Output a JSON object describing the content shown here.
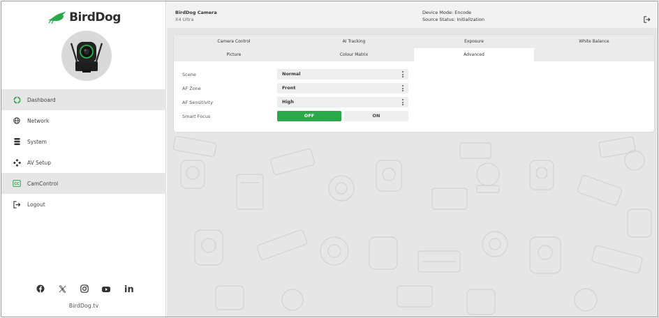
{
  "sidebar": {
    "brand": "BirdDog",
    "nav": [
      {
        "label": "Dashboard",
        "icon": "dashboard-icon",
        "active": true
      },
      {
        "label": "Network",
        "icon": "globe-icon",
        "active": false
      },
      {
        "label": "System",
        "icon": "database-icon",
        "active": false
      },
      {
        "label": "AV Setup",
        "icon": "av-setup-icon",
        "active": false
      },
      {
        "label": "CamControl",
        "icon": "cc-icon",
        "active": true
      },
      {
        "label": "Logout",
        "icon": "logout-icon",
        "active": false
      }
    ],
    "socials": [
      "facebook-icon",
      "x-icon",
      "instagram-icon",
      "youtube-icon",
      "linkedin-icon"
    ],
    "site": "BirdDog.tv"
  },
  "header": {
    "camera_name": "BirdDog Camera",
    "camera_model": "X4 Ultra",
    "device_mode": "Device Mode: Encode",
    "source_status": "Source Status: Initialization"
  },
  "tabs": {
    "row1": [
      "Camera Control",
      "AI Tracking",
      "Exposure",
      "White Balance"
    ],
    "row2": [
      "Picture",
      "Colour Matrix",
      "Advanced"
    ],
    "active": "Advanced"
  },
  "settings": {
    "scene": {
      "label": "Scene",
      "value": "Normal"
    },
    "af_zone": {
      "label": "AF Zone",
      "value": "Front"
    },
    "af_sensitivity": {
      "label": "AF Sensitivity",
      "value": "High"
    },
    "smart_focus": {
      "label": "Smart Focus",
      "off_label": "OFF",
      "on_label": "ON",
      "selected": "OFF"
    }
  },
  "colors": {
    "accent_green": "#2ba84a",
    "active_nav": "#e6e6e6",
    "background": "#e6e6e6"
  }
}
